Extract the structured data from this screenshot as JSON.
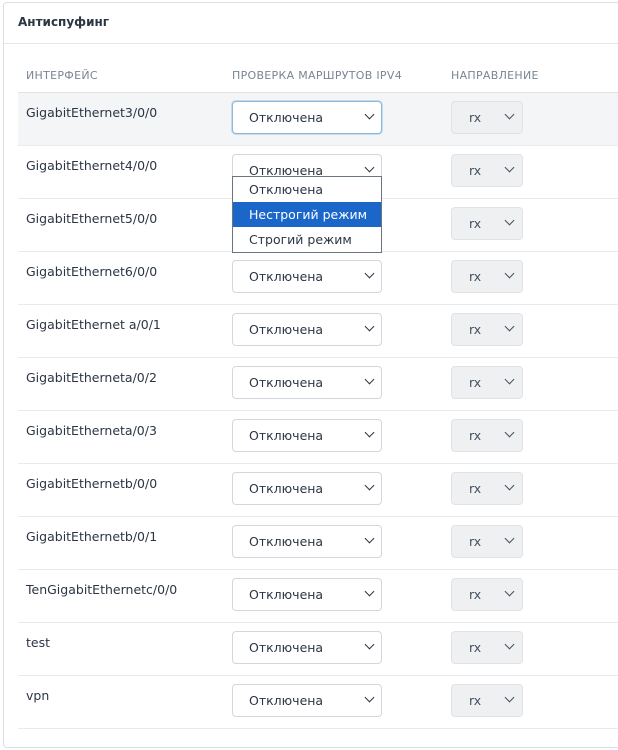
{
  "panel": {
    "title": "Антиспуфинг"
  },
  "columns": {
    "interface": "ИНТЕРФЕЙС",
    "route_check": "ПРОВЕРКА МАРШРУТОВ IPV4",
    "direction": "НАПРАВЛЕНИЕ"
  },
  "rows": [
    {
      "interface": "GigabitEthernet3/0/0",
      "route_check": "Отключена",
      "direction": "rx"
    },
    {
      "interface": "GigabitEthernet4/0/0",
      "route_check": "Отключена",
      "direction": "rx"
    },
    {
      "interface": "GigabitEthernet5/0/0",
      "route_check": "Отключена",
      "direction": "rx"
    },
    {
      "interface": "GigabitEthernet6/0/0",
      "route_check": "Отключена",
      "direction": "rx"
    },
    {
      "interface": "GigabitEthernet a/0/1",
      "route_check": "Отключена",
      "direction": "rx"
    },
    {
      "interface": "GigabitEtherneta/0/2",
      "route_check": "Отключена",
      "direction": "rx"
    },
    {
      "interface": "GigabitEtherneta/0/3",
      "route_check": "Отключена",
      "direction": "rx"
    },
    {
      "interface": "GigabitEthernetb/0/0",
      "route_check": "Отключена",
      "direction": "rx"
    },
    {
      "interface": "GigabitEthernetb/0/1",
      "route_check": "Отключена",
      "direction": "rx"
    },
    {
      "interface": "TenGigabitEthernetc/0/0",
      "route_check": "Отключена",
      "direction": "rx"
    },
    {
      "interface": "test",
      "route_check": "Отключена",
      "direction": "rx"
    },
    {
      "interface": "vpn",
      "route_check": "Отключена",
      "direction": "rx"
    }
  ],
  "dropdown": {
    "options": [
      "Отключена",
      "Нестрогий режим",
      "Строгий режим"
    ],
    "highlighted": "Нестрогий режим"
  },
  "colors": {
    "highlight": "#1a66c9",
    "focus_border": "#8fb8d8"
  }
}
